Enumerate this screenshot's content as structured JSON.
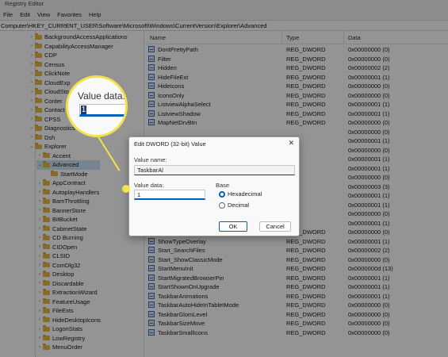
{
  "window": {
    "title": "Registry Editor"
  },
  "menu": [
    "File",
    "Edit",
    "View",
    "Favorites",
    "Help"
  ],
  "address": "Computer\\HKEY_CURRENT_USER\\Software\\Microsoft\\Windows\\CurrentVersion\\Explorer\\Advanced",
  "tree": {
    "items": [
      {
        "label": "BackgroundAccessApplications",
        "level": 0
      },
      {
        "label": "CapabilityAccessManager",
        "level": 0
      },
      {
        "label": "CDP",
        "level": 0
      },
      {
        "label": "Census",
        "level": 0
      },
      {
        "label": "ClickNote",
        "level": 0
      },
      {
        "label": "CloudExp",
        "level": 0
      },
      {
        "label": "CloudSto",
        "level": 0
      },
      {
        "label": "Conter",
        "level": 0
      },
      {
        "label": "Contact",
        "level": 0
      },
      {
        "label": "CPSS",
        "level": 0
      },
      {
        "label": "Diagnostics",
        "level": 0
      },
      {
        "label": "Dsh",
        "level": 0
      },
      {
        "label": "Explorer",
        "level": 0,
        "expanded": true
      },
      {
        "label": "Accent",
        "level": 1
      },
      {
        "label": "Advanced",
        "level": 1,
        "expanded": true,
        "selected": true
      },
      {
        "label": "StartMode",
        "level": 2
      },
      {
        "label": "AppContract",
        "level": 1
      },
      {
        "label": "AutoplayHandlers",
        "level": 1
      },
      {
        "label": "BamThrottling",
        "level": 1
      },
      {
        "label": "BannerStore",
        "level": 1
      },
      {
        "label": "BitBucket",
        "level": 1
      },
      {
        "label": "CabinetState",
        "level": 1
      },
      {
        "label": "CD Burning",
        "level": 1
      },
      {
        "label": "CIDOpen",
        "level": 1
      },
      {
        "label": "CLSID",
        "level": 1
      },
      {
        "label": "ComDlg32",
        "level": 1
      },
      {
        "label": "Desktop",
        "level": 1
      },
      {
        "label": "Discardable",
        "level": 1
      },
      {
        "label": "ExtractionWizard",
        "level": 1
      },
      {
        "label": "FeatureUsage",
        "level": 1
      },
      {
        "label": "FileExts",
        "level": 1
      },
      {
        "label": "HideDesktopIcons",
        "level": 1
      },
      {
        "label": "LogonStats",
        "level": 1
      },
      {
        "label": "LowRegistry",
        "level": 1
      },
      {
        "label": "MenuOrder",
        "level": 1
      }
    ]
  },
  "list": {
    "headers": {
      "name": "Name",
      "type": "Type",
      "data": "Data"
    },
    "rows": [
      {
        "name": "DontPrettyPath",
        "type": "REG_DWORD",
        "data": "0x00000000 (0)"
      },
      {
        "name": "Filter",
        "type": "REG_DWORD",
        "data": "0x00000000 (0)"
      },
      {
        "name": "Hidden",
        "type": "REG_DWORD",
        "data": "0x00000002 (2)"
      },
      {
        "name": "HideFileExt",
        "type": "REG_DWORD",
        "data": "0x00000001 (1)"
      },
      {
        "name": "HideIcons",
        "type": "REG_DWORD",
        "data": "0x00000000 (0)"
      },
      {
        "name": "IconsOnly",
        "type": "REG_DWORD",
        "data": "0x00000000 (0)"
      },
      {
        "name": "ListviewAlphaSelect",
        "type": "REG_DWORD",
        "data": "0x00000001 (1)"
      },
      {
        "name": "ListviewShadow",
        "type": "REG_DWORD",
        "data": "0x00000001 (1)"
      },
      {
        "name": "MapNetDrvBtn",
        "type": "REG_DWORD",
        "data": "0x00000000 (0)"
      },
      {
        "name": "",
        "type": "",
        "data": "0x00000000 (0)"
      },
      {
        "name": "",
        "type": "",
        "data": "0x00000001 (1)"
      },
      {
        "name": "",
        "type": "",
        "data": "0x00000000 (0)"
      },
      {
        "name": "",
        "type": "",
        "data": "0x00000001 (1)"
      },
      {
        "name": "",
        "type": "",
        "data": "0x00000001 (1)"
      },
      {
        "name": "",
        "type": "",
        "data": "0x00000000 (0)"
      },
      {
        "name": "",
        "type": "",
        "data": "0x00000003 (3)"
      },
      {
        "name": "",
        "type": "",
        "data": "0x00000001 (1)"
      },
      {
        "name": "",
        "type": "",
        "data": "0x00000001 (1)"
      },
      {
        "name": "",
        "type": "",
        "data": "0x00000000 (0)"
      },
      {
        "name": "",
        "type": "",
        "data": "0x00000001 (1)"
      },
      {
        "name": "ShowSuperHidden",
        "type": "REG_DWORD",
        "data": "0x00000000 (0)"
      },
      {
        "name": "ShowTypeOverlay",
        "type": "REG_DWORD",
        "data": "0x00000001 (1)"
      },
      {
        "name": "Start_SearchFiles",
        "type": "REG_DWORD",
        "data": "0x00000002 (2)"
      },
      {
        "name": "Start_ShowClassicMode",
        "type": "REG_DWORD",
        "data": "0x00000000 (0)"
      },
      {
        "name": "StartMenuInit",
        "type": "REG_DWORD",
        "data": "0x0000000d (13)"
      },
      {
        "name": "StartMigratedBrowserPin",
        "type": "REG_DWORD",
        "data": "0x00000001 (1)"
      },
      {
        "name": "StartShownOnUpgrade",
        "type": "REG_DWORD",
        "data": "0x00000001 (1)"
      },
      {
        "name": "TaskbarAnimations",
        "type": "REG_DWORD",
        "data": "0x00000001 (1)"
      },
      {
        "name": "TaskbarAutoHideInTabletMode",
        "type": "REG_DWORD",
        "data": "0x00000000 (0)"
      },
      {
        "name": "TaskbarGlomLevel",
        "type": "REG_DWORD",
        "data": "0x00000000 (0)"
      },
      {
        "name": "TaskbarSizeMove",
        "type": "REG_DWORD",
        "data": "0x00000000 (0)"
      },
      {
        "name": "TaskbarSmallIcons",
        "type": "REG_DWORD",
        "data": "0x00000000 (0)"
      }
    ]
  },
  "dialog": {
    "title": "Edit DWORD (32-bit) Value",
    "value_name_label": "Value name:",
    "value_name": "TaskbarAl",
    "value_data_label": "Value data:",
    "value_data": "1",
    "base_label": "Base",
    "hex_label": "Hexadecimal",
    "dec_label": "Decimal",
    "ok_label": "OK",
    "cancel_label": "Cancel",
    "close_glyph": "✕"
  },
  "callout": {
    "label": "Value data:",
    "value": "1"
  },
  "colors": {
    "highlight": "#f4e04d",
    "accent": "#005fb8"
  }
}
